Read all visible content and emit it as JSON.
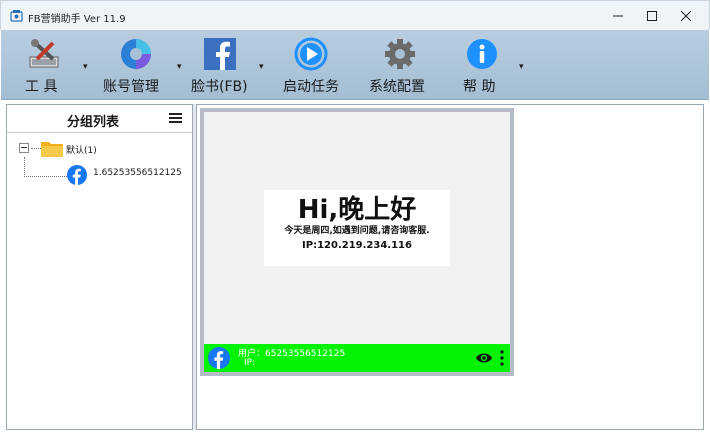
{
  "window": {
    "title": "FB营销助手 Ver 11.9"
  },
  "toolbar": {
    "items": [
      {
        "label": "工 具",
        "icon": "tools-icon"
      },
      {
        "label": "账号管理",
        "icon": "account-manage-icon"
      },
      {
        "label": "脸书(FB)",
        "icon": "facebook-icon"
      },
      {
        "label": "启动任务",
        "icon": "play-icon"
      },
      {
        "label": "系统配置",
        "icon": "gear-icon"
      },
      {
        "label": "帮 助",
        "icon": "info-icon"
      }
    ]
  },
  "sidebar": {
    "title": "分组列表",
    "group": {
      "label": "默认(1)"
    },
    "account": {
      "label": "1.65253556512125"
    }
  },
  "card": {
    "greeting": "Hi,晚上好",
    "message": "今天是周四,如遇到问题,请咨询客服.",
    "ip_line": "IP:120.219.234.116",
    "user_line": "用户：65253556512125",
    "ip_label": "IP:"
  },
  "colors": {
    "toolbar_bg": "#a9c1d6",
    "card_bar": "#04f304",
    "facebook_blue": "#1877f2"
  }
}
